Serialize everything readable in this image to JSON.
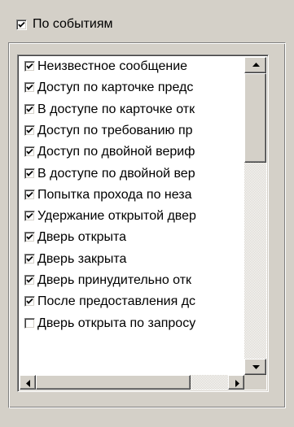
{
  "header": {
    "by_events_label": "По событиям",
    "by_events_checked": true
  },
  "events": {
    "items": [
      {
        "label": "Неизвестное сообщение",
        "checked": true
      },
      {
        "label": "Доступ по карточке предс",
        "checked": true
      },
      {
        "label": "В доступе по карточке отк",
        "checked": true
      },
      {
        "label": "Доступ по требованию пр",
        "checked": true
      },
      {
        "label": "Доступ по двойной вериф",
        "checked": true
      },
      {
        "label": "В доступе по двойной вер",
        "checked": true
      },
      {
        "label": "Попытка прохода по неза",
        "checked": true
      },
      {
        "label": "Удержание открытой двер",
        "checked": true
      },
      {
        "label": "Дверь открыта",
        "checked": true
      },
      {
        "label": "Дверь закрыта",
        "checked": true
      },
      {
        "label": "Дверь принудительно отк",
        "checked": true
      },
      {
        "label": "После предоставления дс",
        "checked": true
      },
      {
        "label": "Дверь открыта по запросу",
        "checked": false
      }
    ]
  }
}
